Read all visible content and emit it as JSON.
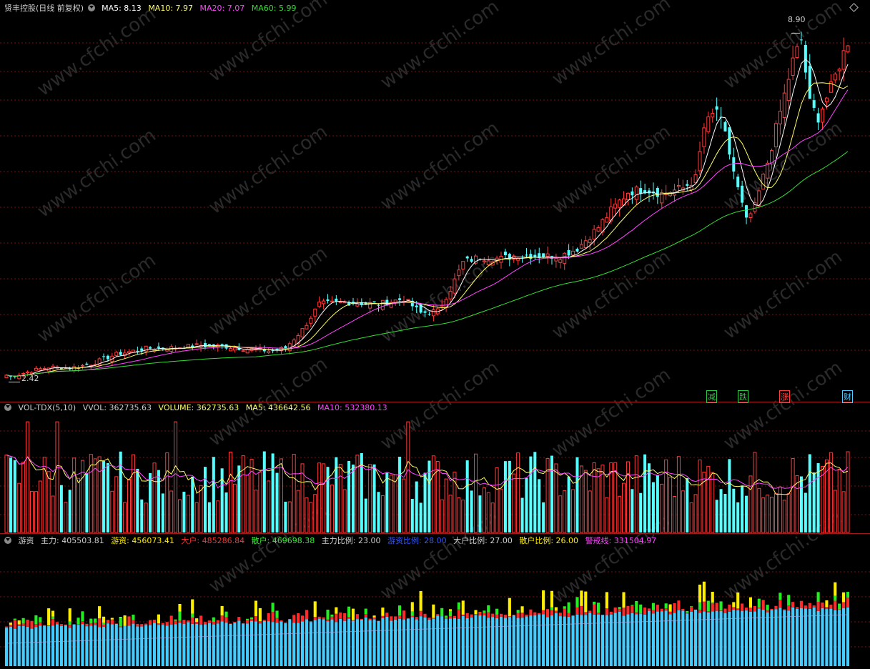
{
  "panels": {
    "price": {
      "title": "贤丰控股(日线 前复权)",
      "ma5_label": "MA5: 8.13",
      "ma10_label": "MA10: 7.97",
      "ma20_label": "MA20: 7.07",
      "ma60_label": "MA60: 5.99",
      "high_label": "8.90",
      "low_label": "2.42"
    },
    "volume": {
      "title": "VOL-TDX(5,10)",
      "vvol_label": "VVOL: 362735.63",
      "volume_label": "VOLUME: 362735.63",
      "ma5_label": "MA5: 436642.56",
      "ma10_label": "MA10: 532380.13"
    },
    "capital": {
      "title": "游资",
      "zhuli_label": "主力: 405503.81",
      "youzi_label": "游资: 456073.41",
      "dahu_label": "大户: 485286.84",
      "sanhu_label": "散户: 469698.38",
      "zhuli_ratio_label": "主力比例: 23.00",
      "youzi_ratio_label": "游资比例: 28.00",
      "dahu_ratio_label": "大户比例: 27.00",
      "sanhu_ratio_label": "散户比例: 26.00",
      "warning_label": "警戒线: 331504.97"
    }
  },
  "event_markers": [
    {
      "text": "减",
      "color": "#2ecc40"
    },
    {
      "text": "跌",
      "color": "#2ecc40"
    },
    {
      "text": "涨",
      "color": "#ff4040"
    },
    {
      "text": "财",
      "color": "#55ccff"
    }
  ],
  "watermark": "www.cfchi.com",
  "colors": {
    "up": "#ff3b3b",
    "down": "#55ffff",
    "ma5": "#ffffff",
    "ma10": "#ffff66",
    "ma20": "#ff44ff",
    "ma60": "#33dd33",
    "grid": "#7a0f0f",
    "zhuli": "#44ccff",
    "youzi": "#ffee00",
    "dahu": "#ff2a2a",
    "sanhu": "#22ee22"
  },
  "chart_data": [
    {
      "type": "candlestick",
      "title": "贤丰控股(日线 前复权)",
      "x_count": 200,
      "ylim": [
        2.2,
        9.2
      ],
      "y_axis_shown": false,
      "price_keypoints": [
        [
          0,
          2.42
        ],
        [
          6,
          2.55
        ],
        [
          10,
          2.62
        ],
        [
          15,
          2.6
        ],
        [
          20,
          2.68
        ],
        [
          26,
          2.86
        ],
        [
          33,
          2.97
        ],
        [
          39,
          2.98
        ],
        [
          46,
          3.03
        ],
        [
          51,
          3.01
        ],
        [
          58,
          2.95
        ],
        [
          63,
          2.92
        ],
        [
          66,
          2.98
        ],
        [
          70,
          3.32
        ],
        [
          74,
          3.8
        ],
        [
          80,
          3.83
        ],
        [
          88,
          3.8
        ],
        [
          94,
          3.9
        ],
        [
          98,
          3.63
        ],
        [
          102,
          3.67
        ],
        [
          105,
          4.08
        ],
        [
          108,
          4.58
        ],
        [
          112,
          4.68
        ],
        [
          117,
          4.65
        ],
        [
          121,
          4.72
        ],
        [
          126,
          4.7
        ],
        [
          131,
          4.7
        ],
        [
          135,
          4.84
        ],
        [
          140,
          5.24
        ],
        [
          143,
          5.55
        ],
        [
          147,
          5.9
        ],
        [
          151,
          5.95
        ],
        [
          155,
          5.87
        ],
        [
          160,
          5.97
        ],
        [
          163,
          6.15
        ],
        [
          165,
          7.1
        ],
        [
          168,
          7.45
        ],
        [
          170,
          6.95
        ],
        [
          173,
          5.95
        ],
        [
          175,
          5.35
        ],
        [
          177,
          5.62
        ],
        [
          180,
          6.45
        ],
        [
          183,
          7.4
        ],
        [
          186,
          8.35
        ],
        [
          188,
          8.75
        ],
        [
          190,
          7.55
        ],
        [
          192,
          7.3
        ],
        [
          195,
          7.85
        ],
        [
          199,
          8.72
        ]
      ],
      "high": 8.9,
      "low": 2.42,
      "series": [
        {
          "name": "MA5",
          "value": 8.13
        },
        {
          "name": "MA10",
          "value": 7.97
        },
        {
          "name": "MA20",
          "value": 7.07
        },
        {
          "name": "MA60",
          "value": 5.99
        }
      ]
    },
    {
      "type": "bar",
      "title": "VOL-TDX(5,10)",
      "x_count": 200,
      "series": [
        {
          "name": "VOLUME",
          "value": 362735.63
        },
        {
          "name": "MA5",
          "value": 436642.56
        },
        {
          "name": "MA10",
          "value": 532380.13
        }
      ]
    },
    {
      "type": "bar",
      "title": "游资",
      "stacked": true,
      "x_count": 200,
      "series": [
        {
          "name": "主力",
          "value": 405503.81
        },
        {
          "name": "游资",
          "value": 456073.41
        },
        {
          "name": "大户",
          "value": 485286.84
        },
        {
          "name": "散户",
          "value": 469698.38
        },
        {
          "name": "警戒线",
          "value": 331504.97
        }
      ],
      "ratios": {
        "主力比例": 23.0,
        "游资比例": 28.0,
        "大户比例": 27.0,
        "散户比例": 26.0
      }
    }
  ]
}
